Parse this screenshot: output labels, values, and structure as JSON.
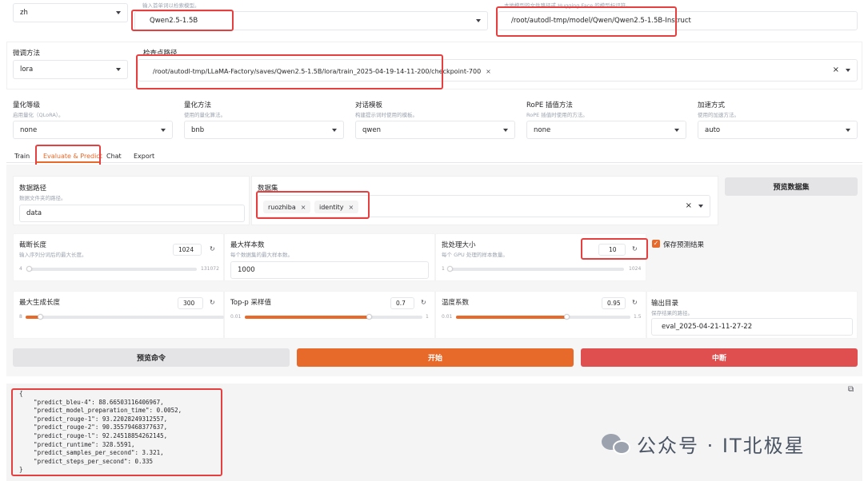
{
  "top": {
    "lang_value": "zh",
    "model_hint": "输入首单词以检索模型。",
    "model_value": "Qwen2.5-1.5B",
    "path_hint": "本地模型的文件路径或 Hugging Face 的模型标识符。",
    "path_value": "/root/autodl-tmp/model/Qwen/Qwen2.5-1.5B-Instruct"
  },
  "finetune": {
    "method_label": "微调方法",
    "method_value": "lora",
    "checkpoint_label": "检查点路径",
    "checkpoint_value": "/root/autodl-tmp/LLaMA-Factory/saves/Qwen2.5-1.5B/lora/train_2025-04-19-14-11-200/checkpoint-700",
    "chip_close": "×",
    "clear": "×"
  },
  "advanced": [
    {
      "label": "量化等级",
      "info": "启用量化（QLoRA）。",
      "value": "none"
    },
    {
      "label": "量化方法",
      "info": "使用的量化算法。",
      "value": "bnb"
    },
    {
      "label": "对话模板",
      "info": "构建提示词时使用的模板。",
      "value": "qwen"
    },
    {
      "label": "RoPE 插值方法",
      "info": "RoPE 插值时使用的方法。",
      "value": "none"
    },
    {
      "label": "加速方式",
      "info": "使用的加速方法。",
      "value": "auto"
    }
  ],
  "tabs": [
    "Train",
    "Evaluate & Predict",
    "Chat",
    "Export"
  ],
  "active_tab": "Evaluate & Predict",
  "dataset": {
    "dir_label": "数据路径",
    "dir_info": "数据文件夹的路径。",
    "dir_value": "data",
    "ds_label": "数据集",
    "chips": [
      "ruozhiba",
      "identity"
    ],
    "chip_close": "×",
    "clear": "×",
    "preview_button": "预览数据集"
  },
  "row1": {
    "cutoff_label": "截断长度",
    "cutoff_info": "输入序列分词后的最大长度。",
    "cutoff_value": "1024",
    "cutoff_min": "4",
    "cutoff_max": "131072",
    "cutoff_fraction": 0.0078,
    "maxsamples_label": "最大样本数",
    "maxsamples_info": "每个数据集的最大样本数。",
    "maxsamples_value": "1000",
    "batch_label": "批处理大小",
    "batch_info": "每个 GPU 处理的样本数量。",
    "batch_value": "10",
    "batch_min": "1",
    "batch_max": "1024",
    "batch_fraction": 0.009,
    "save_label": "保存预测结果",
    "save_check": "✓"
  },
  "row2": {
    "maxnew_label": "最大生成长度",
    "maxnew_value": "300",
    "maxnew_min": "8",
    "maxnew_max": "4096",
    "maxnew_fraction": 0.071,
    "topp_label": "Top-p 采样值",
    "topp_value": "0.7",
    "topp_min": "0.01",
    "topp_max": "1",
    "topp_fraction": 0.697,
    "temp_label": "温度系数",
    "temp_value": "0.95",
    "temp_min": "0.01",
    "temp_max": "1.5",
    "temp_fraction": 0.631,
    "outdir_label": "输出目录",
    "outdir_info": "保存结果的路径。",
    "outdir_value": "eval_2025-04-21-11-27-22"
  },
  "reset_icon": "↻",
  "buttons": {
    "preview_cmd": "预览命令",
    "start": "开始",
    "abort": "中断"
  },
  "output": "{\n    \"predict_bleu-4\": 88.66503116406967,\n    \"predict_model_preparation_time\": 0.0052,\n    \"predict_rouge-1\": 93.22028249312557,\n    \"predict_rouge-2\": 90.35579468377637,\n    \"predict_rouge-l\": 92.24518854262145,\n    \"predict_runtime\": 328.5591,\n    \"predict_samples_per_second\": 3.321,\n    \"predict_steps_per_second\": 0.335\n}",
  "copy_icon": "⧉",
  "watermark": "公众号 · IT北极星",
  "colors": {
    "accent": "#e86a2b",
    "abort": "#e04f4f",
    "highlight": "#e63f3f"
  }
}
